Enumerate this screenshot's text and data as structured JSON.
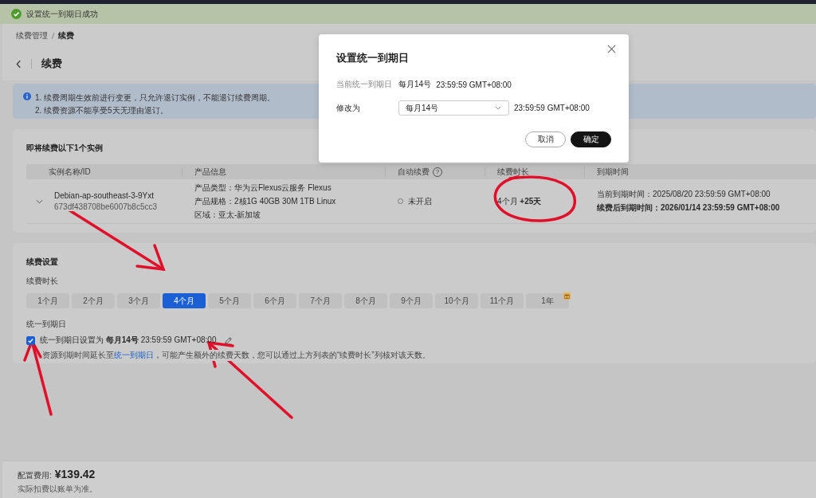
{
  "toast": {
    "text": "设置统一到期日成功"
  },
  "breadcrumb": [
    {
      "label": "续费管理",
      "current": false
    },
    {
      "label": "续费",
      "current": true
    }
  ],
  "page_title": "续费",
  "notice": [
    "1. 续费周期生效前进行变更，只允许退订实例，不能退订续费周期。",
    "2. 续费资源不能享受5天无理由退订。"
  ],
  "instances": {
    "title": "即将续费以下1个实例",
    "columns": [
      {
        "label": "实例名称/ID"
      },
      {
        "label": "产品信息"
      },
      {
        "label": "自动续费",
        "help_icon": "?"
      },
      {
        "label": "续费时长"
      },
      {
        "label": "到期时间"
      }
    ],
    "rows": [
      {
        "expanded": false,
        "name": "Debian-ap-southeast-3-9Yxt",
        "id": "673df438708be6007b8c5cc3",
        "product": [
          "产品类型：华为云Flexus云服务 Flexus",
          "产品规格：2核1G 40GB 30M 1TB Linux",
          "区域：亚太-新加坡"
        ],
        "auto_renew": {
          "text": "未开启",
          "on": false
        },
        "duration": "4个月 **+25天**",
        "expiry_current": "当前到期时间：2025/08/20 23:59:59 GMT+08:00",
        "expiry_after": "续费后到期时间：2026/01/14 23:59:59 GMT+08:00"
      }
    ]
  },
  "renew_settings": {
    "title": "续费设置",
    "duration_label": "续费时长",
    "options": [
      {
        "label": "1个月",
        "selected": false,
        "gift": false
      },
      {
        "label": "2个月",
        "selected": false,
        "gift": false
      },
      {
        "label": "3个月",
        "selected": false,
        "gift": false
      },
      {
        "label": "4个月",
        "selected": true,
        "gift": false
      },
      {
        "label": "5个月",
        "selected": false,
        "gift": false
      },
      {
        "label": "6个月",
        "selected": false,
        "gift": false
      },
      {
        "label": "7个月",
        "selected": false,
        "gift": false
      },
      {
        "label": "8个月",
        "selected": false,
        "gift": false
      },
      {
        "label": "9个月",
        "selected": false,
        "gift": false
      },
      {
        "label": "10个月",
        "selected": false,
        "gift": false
      },
      {
        "label": "11个月",
        "selected": false,
        "gift": false
      },
      {
        "label": "1年",
        "selected": false,
        "gift": true
      }
    ],
    "unify_label": "统一到期日",
    "unify": {
      "checked": true,
      "text": "统一到期日设置为 **每月14号** 23:59:59 GMT+08:00"
    },
    "hint_before": "资源到期时间延长至",
    "hint_link": "统一到期日",
    "hint_after": "，可能产生额外的续费天数，您可以通过上方列表的“续费时长”列核对该天数。"
  },
  "footer": {
    "cost_label": "配置费用:",
    "cost": "¥139.42",
    "note": "实际扣费以账单为准。"
  },
  "modal": {
    "title": "设置统一到期日",
    "current_label": "当前统一到期日",
    "current_day": "每月14号",
    "current_time": "23:59:59 GMT+08:00",
    "change_label": "修改为",
    "select_value": "每月14号",
    "change_time": "23:59:59 GMT+08:00",
    "buttons": [
      {
        "label": "取消",
        "kind": "secondary"
      },
      {
        "label": "确定",
        "kind": "primary"
      }
    ]
  }
}
